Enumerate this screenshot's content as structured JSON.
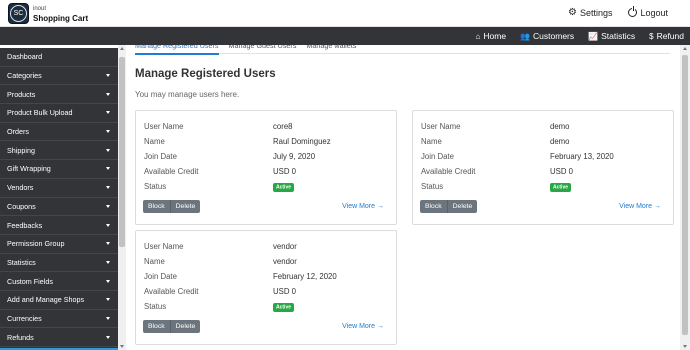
{
  "brand": {
    "mark": "SC",
    "line1": "inout",
    "line2": "Shopping Cart"
  },
  "top_right": {
    "settings": "Settings",
    "logout": "Logout"
  },
  "navbar": [
    {
      "icon": "home-icon",
      "glyph": "⌂",
      "label": "Home"
    },
    {
      "icon": "customers-icon",
      "glyph": "👥",
      "label": "Customers"
    },
    {
      "icon": "statistics-icon",
      "glyph": "📈",
      "label": "Statistics"
    },
    {
      "icon": "refund-icon",
      "glyph": "$",
      "label": "Refund"
    }
  ],
  "sidebar": {
    "items": [
      {
        "label": "Dashboard",
        "has_caret": false
      },
      {
        "label": "Categories",
        "has_caret": true
      },
      {
        "label": "Products",
        "has_caret": true
      },
      {
        "label": "Product Bulk Upload",
        "has_caret": true
      },
      {
        "label": "Orders",
        "has_caret": true
      },
      {
        "label": "Shipping",
        "has_caret": true
      },
      {
        "label": "Gift Wrapping",
        "has_caret": true
      },
      {
        "label": "Vendors",
        "has_caret": true
      },
      {
        "label": "Coupons",
        "has_caret": true
      },
      {
        "label": "Feedbacks",
        "has_caret": true
      },
      {
        "label": "Permission Group",
        "has_caret": true
      },
      {
        "label": "Statistics",
        "has_caret": true
      },
      {
        "label": "Custom Fields",
        "has_caret": true
      },
      {
        "label": "Add and Manage Shops",
        "has_caret": true
      },
      {
        "label": "Currencies",
        "has_caret": true
      },
      {
        "label": "Refunds",
        "has_caret": true
      }
    ]
  },
  "tabs": [
    {
      "label": "Manage Registered Users",
      "active": true
    },
    {
      "label": "Manage Guest Users",
      "active": false
    },
    {
      "label": "Manage wallets",
      "active": false
    }
  ],
  "page": {
    "title": "Manage Registered Users",
    "subtitle": "You may manage users here."
  },
  "field_labels": {
    "username": "User Name",
    "name": "Name",
    "join_date": "Join Date",
    "credit": "Available Credit",
    "status": "Status"
  },
  "users": [
    {
      "username": "core8",
      "name": "Raul Dominguez",
      "join_date": "July 9, 2020",
      "credit": "USD 0",
      "status": "Active",
      "block": "Block",
      "delete": "Delete",
      "view_more": "View More"
    },
    {
      "username": "demo",
      "name": "demo",
      "join_date": "February 13, 2020",
      "credit": "USD 0",
      "status": "Active",
      "block": "Block",
      "delete": "Delete",
      "view_more": "View More"
    },
    {
      "username": "vendor",
      "name": "vendor",
      "join_date": "February 12, 2020",
      "credit": "USD 0",
      "status": "Active",
      "block": "Block",
      "delete": "Delete",
      "view_more": "View More"
    }
  ],
  "colors": {
    "dark": "#333437",
    "accent": "#1f7bd6",
    "active_badge": "#28a745",
    "button": "#6c757d"
  }
}
